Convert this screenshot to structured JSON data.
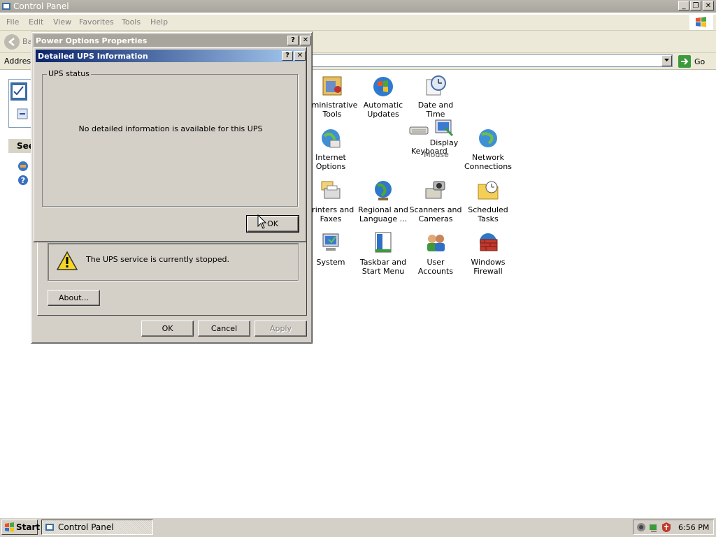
{
  "window": {
    "title": "Control Panel",
    "min_glyph": "_",
    "max_glyph": "❐",
    "close_glyph": "✕"
  },
  "menu": [
    "File",
    "Edit",
    "View",
    "Favorites",
    "Tools",
    "Help"
  ],
  "toolbar": {
    "back_label": "Ba"
  },
  "address": {
    "label": "Address",
    "value": "",
    "go_label": "Go"
  },
  "left_pane": {
    "see_also_label": "See"
  },
  "icons": [
    {
      "label": "dministrative\nTools",
      "icon": "admin-tools-icon"
    },
    {
      "label": "Automatic\nUpdates",
      "icon": "automatic-updates-icon"
    },
    {
      "label": "Date and Time",
      "icon": "date-time-icon"
    },
    {
      "label": "Internet\nOptions",
      "icon": "internet-options-icon"
    },
    {
      "label": "Keyboard",
      "icon": "keyboard-icon"
    },
    {
      "label": "Mouse",
      "icon": "mouse-icon"
    },
    {
      "label": "Display",
      "icon": "display-icon"
    },
    {
      "label": "Network\nConnections",
      "icon": "network-connections-icon"
    },
    {
      "label": "Printers and\nFaxes",
      "icon": "printers-faxes-icon"
    },
    {
      "label": "Regional and\nLanguage ...",
      "icon": "regional-language-icon"
    },
    {
      "label": "Scanners and\nCameras",
      "icon": "scanners-cameras-icon"
    },
    {
      "label": "Scheduled\nTasks",
      "icon": "scheduled-tasks-icon"
    },
    {
      "label": "System",
      "icon": "system-icon"
    },
    {
      "label": "Taskbar and\nStart Menu",
      "icon": "taskbar-start-menu-icon"
    },
    {
      "label": "User Accounts",
      "icon": "user-accounts-icon"
    },
    {
      "label": "Windows\nFirewall",
      "icon": "windows-firewall-icon"
    }
  ],
  "power_dialog": {
    "title": "Power Options Properties",
    "help_glyph": "?",
    "close_glyph": "✕",
    "ups_message": "The UPS service is currently stopped.",
    "about_label": "About...",
    "ok_label": "OK",
    "cancel_label": "Cancel",
    "apply_label": "Apply"
  },
  "ups_dialog": {
    "title": "Detailed UPS Information",
    "help_glyph": "?",
    "close_glyph": "✕",
    "group_label": "UPS status",
    "message": "No detailed information is available for this UPS",
    "ok_label": "OK"
  },
  "taskbar": {
    "start_label": "Start",
    "task_label": "Control Panel",
    "clock": "6:56 PM"
  }
}
